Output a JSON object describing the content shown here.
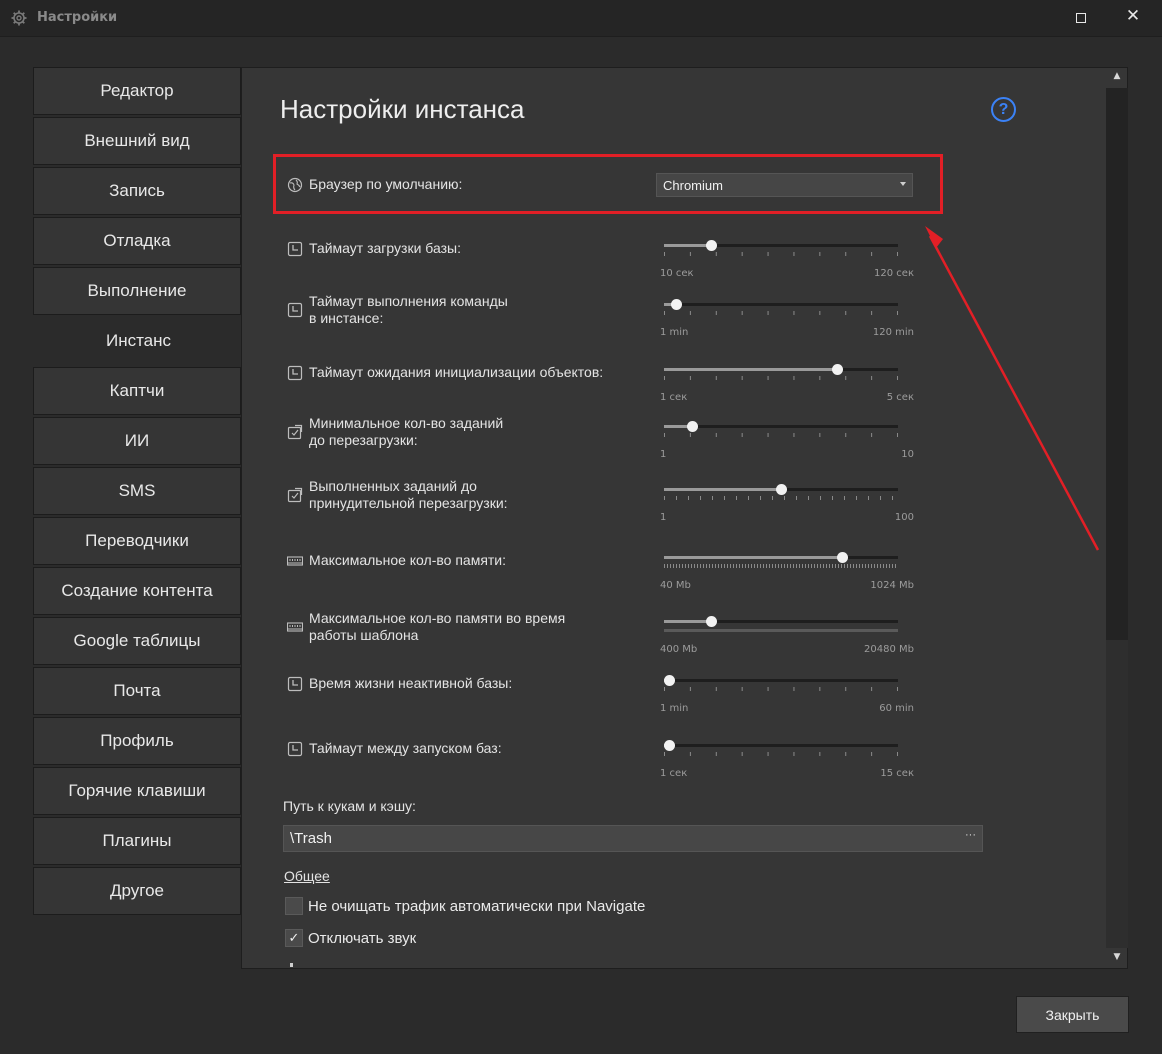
{
  "window": {
    "title": "Настройки",
    "close_glyph": "✕"
  },
  "sidebar": {
    "items": [
      {
        "label": "Редактор"
      },
      {
        "label": "Внешний вид"
      },
      {
        "label": "Запись"
      },
      {
        "label": "Отладка"
      },
      {
        "label": "Выполнение"
      },
      {
        "label": "Инстанс",
        "active": true
      },
      {
        "label": "Каптчи"
      },
      {
        "label": "ИИ"
      },
      {
        "label": "SMS"
      },
      {
        "label": "Переводчики"
      },
      {
        "label": "Создание контента"
      },
      {
        "label": "Google таблицы"
      },
      {
        "label": "Почта"
      },
      {
        "label": "Профиль"
      },
      {
        "label": "Горячие клавиши"
      },
      {
        "label": "Плагины"
      },
      {
        "label": "Другое"
      }
    ]
  },
  "main": {
    "title": "Настройки инстанса",
    "help_glyph": "?",
    "browser": {
      "label": "Браузер по умолчанию:",
      "value": "Chromium",
      "icon": "globe-icon"
    },
    "sliders": [
      {
        "label_lines": [
          "Таймаут загрузки базы:"
        ],
        "icon": "clock-icon",
        "min": "10 сек",
        "max": "120 сек",
        "fraction": 0.2,
        "ticks": "sparse"
      },
      {
        "label_lines": [
          "Таймаут выполнения команды",
          "в инстансе:"
        ],
        "icon": "clock-icon",
        "min": "1 min",
        "max": "120 min",
        "fraction": 0.05,
        "ticks": "sparse"
      },
      {
        "label_lines": [
          "Таймаут ожидания инициализации объектов:"
        ],
        "icon": "clock-icon",
        "min": "1 сек",
        "max": "5 сек",
        "fraction": 0.74,
        "ticks": "sparse"
      },
      {
        "label_lines": [
          "Минимальное кол-во заданий",
          "до перезагрузки:"
        ],
        "icon": "task-icon",
        "min": "1",
        "max": "10",
        "fraction": 0.12,
        "ticks": "sparse"
      },
      {
        "label_lines": [
          "Выполненных заданий до",
          "принудительной перезагрузки:"
        ],
        "icon": "task-icon",
        "min": "1",
        "max": "100",
        "fraction": 0.5,
        "ticks": "medium"
      },
      {
        "label_lines": [
          "Максимальное кол-во памяти:"
        ],
        "icon": "memory-icon",
        "min": "40 Mb",
        "max": "1024 Mb",
        "fraction": 0.76,
        "ticks": "dense"
      },
      {
        "label_lines": [
          "Максимальное кол-во памяти во время",
          "работы шаблона"
        ],
        "icon": "memory-icon",
        "min": "400 Mb",
        "max": "20480 Mb",
        "fraction": 0.2,
        "ticks": "solid"
      },
      {
        "label_lines": [
          "Время жизни неактивной базы:"
        ],
        "icon": "clock-icon",
        "min": "1 min",
        "max": "60 min",
        "fraction": 0.02,
        "ticks": "sparse"
      },
      {
        "label_lines": [
          "Таймаут между запуском баз:"
        ],
        "icon": "clock-icon",
        "min": "1 сек",
        "max": "15 сек",
        "fraction": 0.02,
        "ticks": "sparse"
      }
    ],
    "path": {
      "label": "Путь к кукам и кэшу:",
      "value": "\\Trash",
      "browse_glyph": "···"
    },
    "section_title": "Общее",
    "checkboxes": [
      {
        "label": "Не очищать трафик автоматически при Navigate",
        "checked": false
      },
      {
        "label": "Отключать звук",
        "checked": true
      }
    ]
  },
  "footer": {
    "close_label": "Закрыть"
  },
  "colors": {
    "highlight": "#e21f26",
    "accent_blue": "#3b82f6"
  }
}
